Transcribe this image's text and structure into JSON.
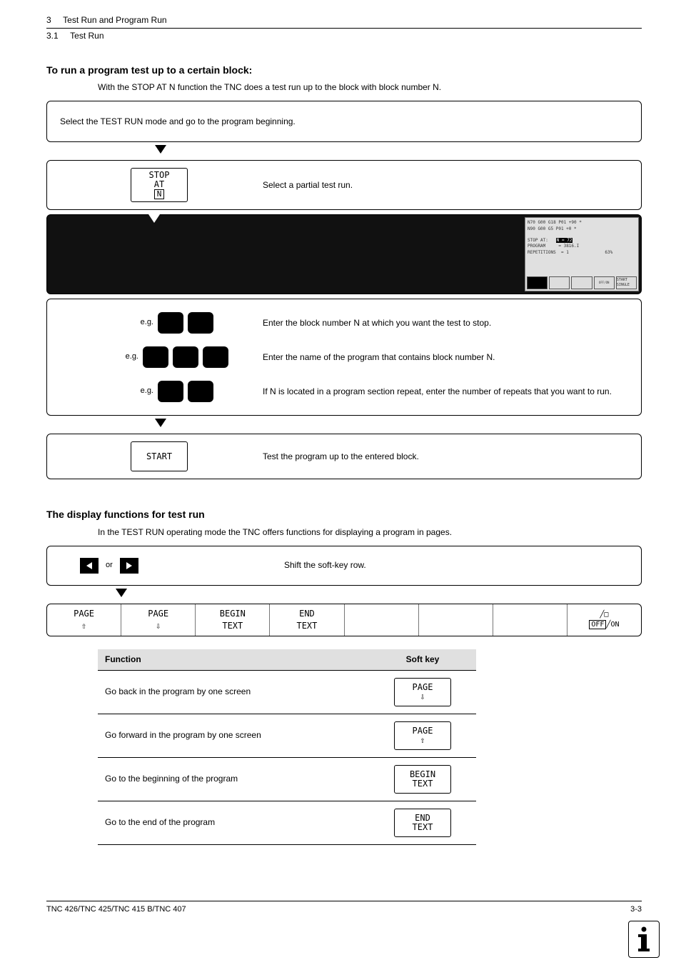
{
  "header": {
    "chapter": "3",
    "chapter_title": "Test Run and Program Run",
    "section": "3.1",
    "section_title": "Test Run"
  },
  "section1": {
    "heading": "To run a program test up to a certain block:",
    "intro": "With the STOP AT N function the TNC does a test run up to the block with block number N.",
    "step1": "Select the TEST RUN mode and go to the program beginning.",
    "softkey_stop": {
      "l1": "STOP",
      "l2": "AT",
      "l3": "N"
    },
    "step2": "Select a partial test run.",
    "screen": {
      "line1": "N70 G00 G18 P01 +90 *",
      "line2": "N90 G00 G5 P01 +0 *",
      "stop_at": "STOP AT:",
      "stop_at_v": "N = 72",
      "prog": "PROGRAM",
      "prog_v": "= 3816.I",
      "reps": "REPETITIONS",
      "reps_v": "= 1",
      "pct": "63%",
      "btn1": "",
      "btn2": "",
      "btn3": "",
      "btn4": "",
      "btn5": "START SINGLE"
    },
    "eg": "e.g.",
    "step3": "Enter the block number N at which you want the test to stop.",
    "step4": "Enter the name of the program that contains block number N.",
    "step5": "If N is located in a program section repeat, enter the number of repeats that you want to run.",
    "softkey_start": "START",
    "step6": "Test the program up to the entered block."
  },
  "section2": {
    "heading": "The display functions for test run",
    "intro": "In the TEST RUN operating mode the TNC offers functions for displaying a program in pages.",
    "shift_label": "or",
    "shift_text": "Shift the soft-key row.",
    "bar": {
      "c1": "PAGE",
      "c2": "PAGE",
      "c3a": "BEGIN",
      "c3b": "TEXT",
      "c4a": "END",
      "c4b": "TEXT",
      "c8a": "OFF",
      "c8b": "ON"
    }
  },
  "table": {
    "h1": "Function",
    "h2": "Soft key",
    "r1": "Go back in the program by one screen",
    "sk1": "PAGE",
    "r2": "Go forward in the program by one screen",
    "sk2": "PAGE",
    "r3": "Go to the beginning of the program",
    "sk3a": "BEGIN",
    "sk3b": "TEXT",
    "r4": "Go to the end of the program",
    "sk4a": "END",
    "sk4b": "TEXT"
  },
  "footer": {
    "left": "TNC 426/TNC 425/TNC 415 B/TNC 407",
    "right": "3-3"
  }
}
